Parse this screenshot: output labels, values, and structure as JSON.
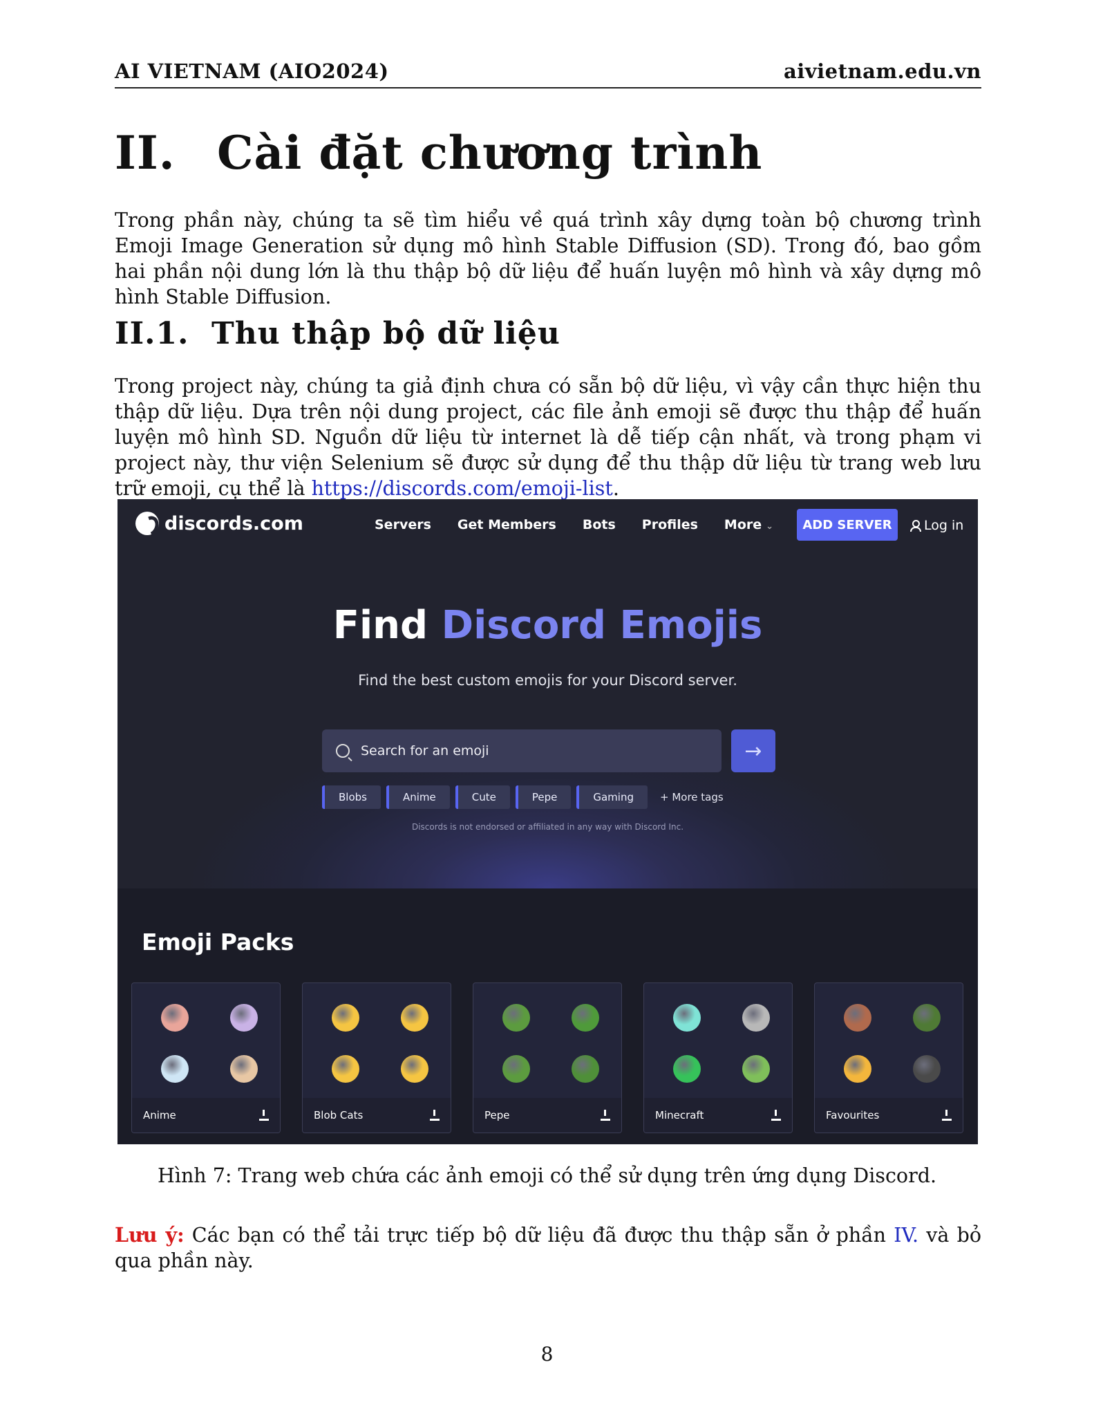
{
  "header": {
    "left": "AI VIETNAM (AIO2024)",
    "right": "aivietnam.edu.vn"
  },
  "section": {
    "number": "II.",
    "title": "Cài đặt chương trình"
  },
  "intro": "Trong phần này, chúng ta sẽ tìm hiểu về quá trình xây dựng toàn bộ chương trình Emoji Image Generation sử dụng mô hình Stable Diffusion (SD). Trong đó, bao gồm hai phần nội dung lớn là thu thập bộ dữ liệu để huấn luyện mô hình và xây dựng mô hình Stable Diffusion.",
  "subsection": {
    "number": "II.1.",
    "title": "Thu thập bộ dữ liệu"
  },
  "body": {
    "text": "Trong project này, chúng ta giả định chưa có sẵn bộ dữ liệu, vì vậy cần thực hiện thu thập dữ liệu. Dựa trên nội dung project, các file ảnh emoji sẽ được thu thập để huấn luyện mô hình SD. Nguồn dữ liệu từ internet là dễ tiếp cận nhất, và trong phạm vi project này, thư viện Selenium sẽ được sử dụng để thu thập dữ liệu từ trang web lưu trữ emoji, cụ thể là ",
    "link": "https://discords.com/emoji-list",
    "end": "."
  },
  "figure": {
    "logo": "discords.com",
    "nav": [
      "Servers",
      "Get Members",
      "Bots",
      "Profiles",
      "More"
    ],
    "add_server": "ADD SERVER",
    "login": "Log in",
    "hero_title_white": "Find ",
    "hero_title_accent": "Discord Emojis",
    "hero_sub": "Find the best custom emojis for your Discord server.",
    "search_placeholder": "Search for an emoji",
    "tags": [
      "Blobs",
      "Anime",
      "Cute",
      "Pepe",
      "Gaming"
    ],
    "more_tags": "+ More tags",
    "disclaimer": "Discords is not endorsed or affiliated in any way with Discord Inc.",
    "packs_title": "Emoji Packs",
    "packs": [
      {
        "name": "Anime",
        "colors": [
          "#e9a59a",
          "#c9b2e6",
          "#cfe6f5",
          "#e8c7a4"
        ]
      },
      {
        "name": "Blob Cats",
        "colors": [
          "#f5c542",
          "#f5c542",
          "#f5c542",
          "#f5c542"
        ]
      },
      {
        "name": "Pepe",
        "colors": [
          "#5c9b3f",
          "#4f9a3a",
          "#5c9b3f",
          "#4f8f39"
        ]
      },
      {
        "name": "Minecraft",
        "colors": [
          "#7fe3d6",
          "#b8b8b8",
          "#36c25a",
          "#7fbf5a"
        ]
      },
      {
        "name": "Favourites",
        "colors": [
          "#b06a4d",
          "#4f7a35",
          "#f3b63c",
          "#4a4a4a"
        ]
      }
    ],
    "accent": "#5865f2"
  },
  "caption": "Hình 7: Trang web chứa các ảnh emoji có thể sử dụng trên ứng dụng Discord.",
  "note": {
    "label": "Lưu ý:",
    "text": " Các bạn có thể tải trực tiếp bộ dữ liệu đã được thu thập sẵn ở phần ",
    "link": "IV.",
    "end": " và bỏ qua phần này."
  },
  "page_number": "8"
}
